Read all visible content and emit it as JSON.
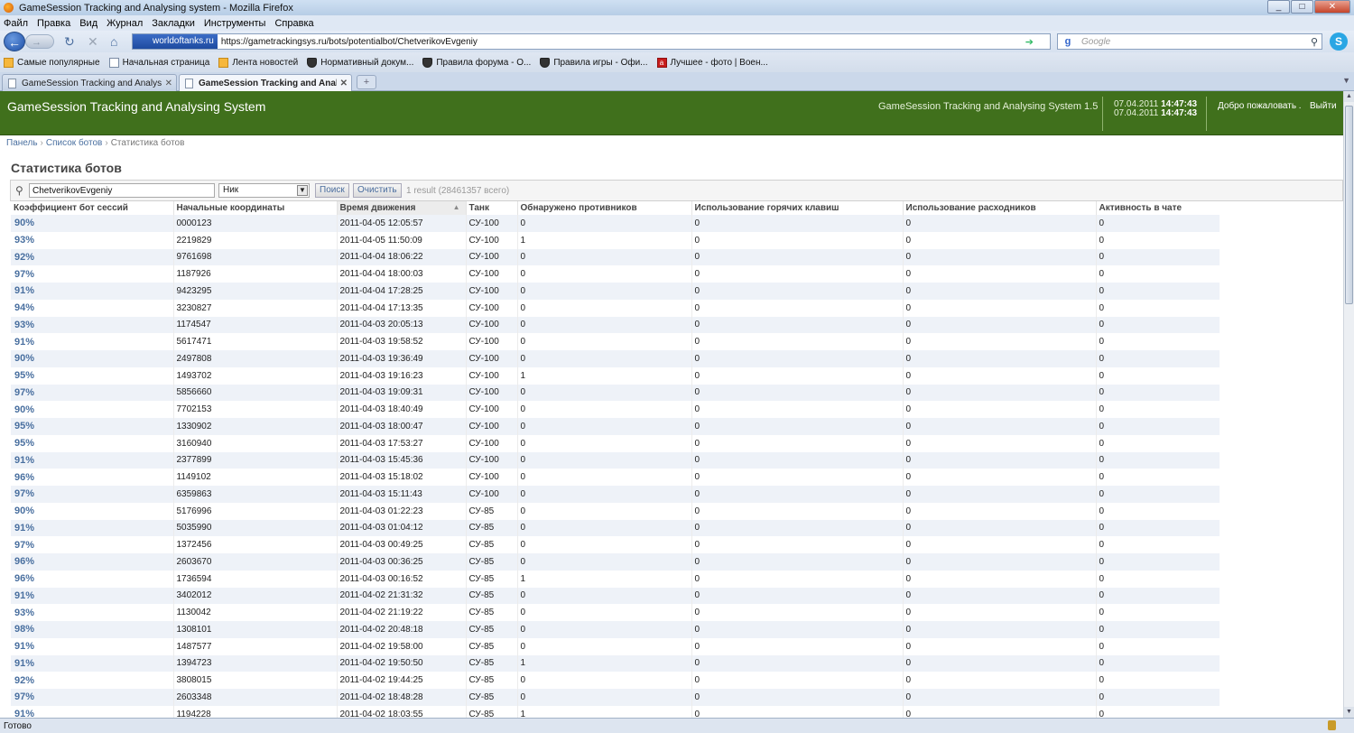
{
  "window": {
    "title": "GameSession Tracking and Analysing system - Mozilla Firefox",
    "min": "_",
    "max": "□",
    "close": "✕"
  },
  "menu": [
    "Файл",
    "Правка",
    "Вид",
    "Журнал",
    "Закладки",
    "Инструменты",
    "Справка"
  ],
  "nav": {
    "back_icon": "←",
    "forward_icon": "→",
    "reload_icon": "↻",
    "stop_icon": "✕",
    "home_icon": "⌂",
    "site_badge": "worldoftanks.ru",
    "url": "https://gametrackingsys.ru/bots/potentialbot/ChetverikovEvgeniy",
    "search_placeholder": "Google",
    "search_engine": "g"
  },
  "bookmarks": [
    {
      "label": "Самые популярные",
      "icon": "orange"
    },
    {
      "label": "Начальная страница",
      "icon": "page"
    },
    {
      "label": "Лента новостей",
      "icon": "orange"
    },
    {
      "label": "Нормативный докум...",
      "icon": "shield"
    },
    {
      "label": "Правила форума - О...",
      "icon": "shield"
    },
    {
      "label": "Правила игры - Офи...",
      "icon": "shield"
    },
    {
      "label": "Лучшее - фото | Воен...",
      "icon": "red"
    }
  ],
  "tabs": [
    {
      "label": "GameSession Tracking and Analysi...",
      "active": false
    },
    {
      "label": "GameSession Tracking and Analys...",
      "active": true
    }
  ],
  "new_tab": "+",
  "app": {
    "title": "GameSession Tracking and Analysing System",
    "version": "GameSession Tracking and Analysing System 1.5",
    "time1_date": "07.04.2011",
    "time1_clock": "14:47:43",
    "time2_date": "07.04.2011",
    "time2_clock": "14:47:43",
    "welcome": "Добро пожаловать .",
    "logout": "Выйти"
  },
  "breadcrumb": {
    "item1": "Панель",
    "item2": "Список ботов",
    "item3": "Статистика ботов",
    "sep": "›"
  },
  "page_title": "Статистика ботов",
  "filter": {
    "query": "ChetverikovEvgeniy",
    "field": "Ник",
    "search_button": "Поиск",
    "clear_button": "Очистить",
    "result": "1 result (28461357 всего)"
  },
  "table": {
    "columns": [
      "Коэффициент бот сессий",
      "Начальные координаты",
      "Время движения",
      "Танк",
      "Обнаружено противников",
      "Использование горячих клавиш",
      "Использование расходников",
      "Активность в чате"
    ],
    "sort_indicator": "▲",
    "rows": [
      [
        "90%",
        "0000123",
        "2011-04-05 12:05:57",
        "СУ-100",
        "0",
        "0",
        "0",
        "0"
      ],
      [
        "93%",
        "2219829",
        "2011-04-05 11:50:09",
        "СУ-100",
        "1",
        "0",
        "0",
        "0"
      ],
      [
        "92%",
        "9761698",
        "2011-04-04 18:06:22",
        "СУ-100",
        "0",
        "0",
        "0",
        "0"
      ],
      [
        "97%",
        "1187926",
        "2011-04-04 18:00:03",
        "СУ-100",
        "0",
        "0",
        "0",
        "0"
      ],
      [
        "91%",
        "9423295",
        "2011-04-04 17:28:25",
        "СУ-100",
        "0",
        "0",
        "0",
        "0"
      ],
      [
        "94%",
        "3230827",
        "2011-04-04 17:13:35",
        "СУ-100",
        "0",
        "0",
        "0",
        "0"
      ],
      [
        "93%",
        "1174547",
        "2011-04-03 20:05:13",
        "СУ-100",
        "0",
        "0",
        "0",
        "0"
      ],
      [
        "91%",
        "5617471",
        "2011-04-03 19:58:52",
        "СУ-100",
        "0",
        "0",
        "0",
        "0"
      ],
      [
        "90%",
        "2497808",
        "2011-04-03 19:36:49",
        "СУ-100",
        "0",
        "0",
        "0",
        "0"
      ],
      [
        "95%",
        "1493702",
        "2011-04-03 19:16:23",
        "СУ-100",
        "1",
        "0",
        "0",
        "0"
      ],
      [
        "97%",
        "5856660",
        "2011-04-03 19:09:31",
        "СУ-100",
        "0",
        "0",
        "0",
        "0"
      ],
      [
        "90%",
        "7702153",
        "2011-04-03 18:40:49",
        "СУ-100",
        "0",
        "0",
        "0",
        "0"
      ],
      [
        "95%",
        "1330902",
        "2011-04-03 18:00:47",
        "СУ-100",
        "0",
        "0",
        "0",
        "0"
      ],
      [
        "95%",
        "3160940",
        "2011-04-03 17:53:27",
        "СУ-100",
        "0",
        "0",
        "0",
        "0"
      ],
      [
        "91%",
        "2377899",
        "2011-04-03 15:45:36",
        "СУ-100",
        "0",
        "0",
        "0",
        "0"
      ],
      [
        "96%",
        "1149102",
        "2011-04-03 15:18:02",
        "СУ-100",
        "0",
        "0",
        "0",
        "0"
      ],
      [
        "97%",
        "6359863",
        "2011-04-03 15:11:43",
        "СУ-100",
        "0",
        "0",
        "0",
        "0"
      ],
      [
        "90%",
        "5176996",
        "2011-04-03 01:22:23",
        "СУ-85",
        "0",
        "0",
        "0",
        "0"
      ],
      [
        "91%",
        "5035990",
        "2011-04-03 01:04:12",
        "СУ-85",
        "0",
        "0",
        "0",
        "0"
      ],
      [
        "97%",
        "1372456",
        "2011-04-03 00:49:25",
        "СУ-85",
        "0",
        "0",
        "0",
        "0"
      ],
      [
        "96%",
        "2603670",
        "2011-04-03 00:36:25",
        "СУ-85",
        "0",
        "0",
        "0",
        "0"
      ],
      [
        "96%",
        "1736594",
        "2011-04-03 00:16:52",
        "СУ-85",
        "1",
        "0",
        "0",
        "0"
      ],
      [
        "91%",
        "3402012",
        "2011-04-02 21:31:32",
        "СУ-85",
        "0",
        "0",
        "0",
        "0"
      ],
      [
        "93%",
        "1130042",
        "2011-04-02 21:19:22",
        "СУ-85",
        "0",
        "0",
        "0",
        "0"
      ],
      [
        "98%",
        "1308101",
        "2011-04-02 20:48:18",
        "СУ-85",
        "0",
        "0",
        "0",
        "0"
      ],
      [
        "91%",
        "1487577",
        "2011-04-02 19:58:00",
        "СУ-85",
        "0",
        "0",
        "0",
        "0"
      ],
      [
        "91%",
        "1394723",
        "2011-04-02 19:50:50",
        "СУ-85",
        "1",
        "0",
        "0",
        "0"
      ],
      [
        "92%",
        "3808015",
        "2011-04-02 19:44:25",
        "СУ-85",
        "0",
        "0",
        "0",
        "0"
      ],
      [
        "97%",
        "2603348",
        "2011-04-02 18:48:28",
        "СУ-85",
        "0",
        "0",
        "0",
        "0"
      ],
      [
        "91%",
        "1194228",
        "2011-04-02 18:03:55",
        "СУ-85",
        "1",
        "0",
        "0",
        "0"
      ]
    ]
  },
  "status": "Готово",
  "colors": {
    "header_green": "#40701c",
    "link_blue": "#4a70a0",
    "row_stripe": "#eef2f8"
  }
}
